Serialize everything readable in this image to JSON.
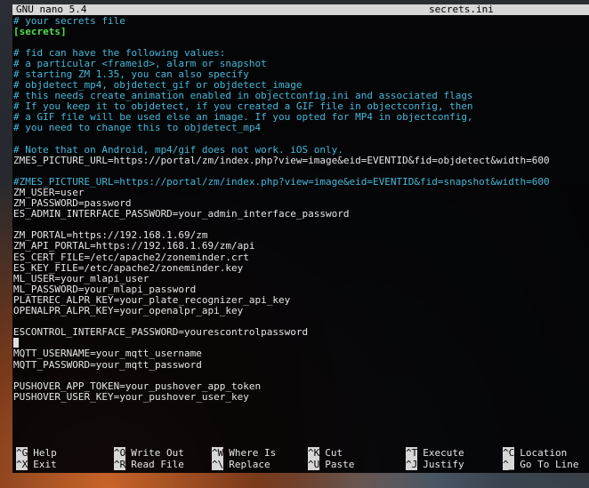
{
  "titlebar": {
    "app_name": "GNU nano 5.4",
    "file_name": "secrets.ini"
  },
  "lines": [
    {
      "text": "# your secrets file",
      "kind": "comment"
    },
    {
      "text": "[secrets]",
      "kind": "section"
    },
    {
      "text": "",
      "kind": "plain"
    },
    {
      "text": "# fid can have the following values:",
      "kind": "comment"
    },
    {
      "text": "# a particular <frameid>, alarm or snapshot",
      "kind": "comment"
    },
    {
      "text": "# starting ZM 1.35, you can also specify",
      "kind": "comment"
    },
    {
      "text": "# objdetect_mp4, objdetect_gif or objdetect_image",
      "kind": "comment"
    },
    {
      "text": "# this needs create_animation enabled in objectconfig.ini and associated flags",
      "kind": "comment"
    },
    {
      "text": "# If you keep it to objdetect, if you created a GIF file in objectconfig, then",
      "kind": "comment"
    },
    {
      "text": "# a GIF file will be used else an image. If you opted for MP4 in objectconfig,",
      "kind": "comment"
    },
    {
      "text": "# you need to change this to objdetect_mp4",
      "kind": "comment"
    },
    {
      "text": "",
      "kind": "plain"
    },
    {
      "text": "# Note that on Android, mp4/gif does not work. iOS only.",
      "kind": "comment"
    },
    {
      "text": "ZMES_PICTURE_URL=https://portal/zm/index.php?view=image&eid=EVENTID&fid=objdetect&width=600",
      "kind": "plain"
    },
    {
      "text": "",
      "kind": "plain"
    },
    {
      "text": "#ZMES_PICTURE_URL=https://portal/zm/index.php?view=image&eid=EVENTID&fid=snapshot&width=600",
      "kind": "comment"
    },
    {
      "text": "ZM_USER=user",
      "kind": "plain"
    },
    {
      "text": "ZM_PASSWORD=password",
      "kind": "plain"
    },
    {
      "text": "ES_ADMIN_INTERFACE_PASSWORD=your_admin_interface_password",
      "kind": "plain"
    },
    {
      "text": "",
      "kind": "plain"
    },
    {
      "text": "ZM_PORTAL=https://192.168.1.69/zm",
      "kind": "plain"
    },
    {
      "text": "ZM_API_PORTAL=https://192.168.1.69/zm/api",
      "kind": "plain"
    },
    {
      "text": "ES_CERT_FILE=/etc/apache2/zoneminder.crt",
      "kind": "plain"
    },
    {
      "text": "ES_KEY_FILE=/etc/apache2/zoneminder.key",
      "kind": "plain"
    },
    {
      "text": "ML_USER=your_mlapi_user",
      "kind": "plain"
    },
    {
      "text": "ML_PASSWORD=your_mlapi_password",
      "kind": "plain"
    },
    {
      "text": "PLATEREC_ALPR_KEY=your_plate_recognizer_api_key",
      "kind": "plain"
    },
    {
      "text": "OPENALPR_ALPR_KEY=your_openalpr_api_key",
      "kind": "plain"
    },
    {
      "text": "",
      "kind": "plain"
    },
    {
      "text": "ESCONTROL_INTERFACE_PASSWORD=yourescontrolpassword",
      "kind": "plain"
    },
    {
      "text": "",
      "kind": "cursor"
    },
    {
      "text": "MQTT_USERNAME=your_mqtt_username",
      "kind": "plain"
    },
    {
      "text": "MQTT_PASSWORD=your_mqtt_password",
      "kind": "plain"
    },
    {
      "text": "",
      "kind": "plain"
    },
    {
      "text": "PUSHOVER_APP_TOKEN=your_pushover_app_token",
      "kind": "plain"
    },
    {
      "text": "PUSHOVER_USER_KEY=your_pushover_user_key",
      "kind": "plain"
    }
  ],
  "shortcuts": [
    {
      "key": "^G",
      "label": "Help",
      "name": "help"
    },
    {
      "key": "^O",
      "label": "Write Out",
      "name": "write-out"
    },
    {
      "key": "^W",
      "label": "Where Is",
      "name": "where-is"
    },
    {
      "key": "^K",
      "label": "Cut",
      "name": "cut"
    },
    {
      "key": "^T",
      "label": "Execute",
      "name": "execute"
    },
    {
      "key": "^C",
      "label": "Location",
      "name": "location"
    },
    {
      "key": "^X",
      "label": "Exit",
      "name": "exit"
    },
    {
      "key": "^R",
      "label": "Read File",
      "name": "read-file"
    },
    {
      "key": "^\\",
      "label": "Replace",
      "name": "replace"
    },
    {
      "key": "^U",
      "label": "Paste",
      "name": "paste"
    },
    {
      "key": "^J",
      "label": "Justify",
      "name": "justify"
    },
    {
      "key": "^_",
      "label": "Go To Line",
      "name": "go-to-line"
    }
  ]
}
